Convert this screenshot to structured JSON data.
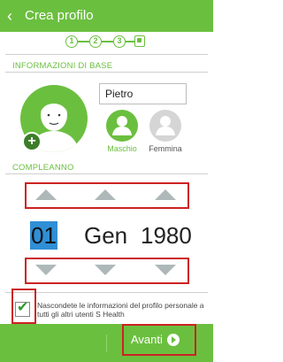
{
  "header": {
    "title": "Crea profilo",
    "back_icon": "arrow-left-icon"
  },
  "steps": {
    "current": 1,
    "labels": [
      "1",
      "2",
      "3"
    ],
    "final_icon": "profile-card-icon"
  },
  "basic_info": {
    "section_title": "INFORMAZIONI DI BASE",
    "name_value": "Pietro",
    "avatar_icon": "person-avatar-icon",
    "add_photo_icon": "plus-icon",
    "gender": {
      "male_label": "Maschio",
      "female_label": "Femmina",
      "selected": "Maschio"
    }
  },
  "birthday": {
    "section_title": "COMPLEANNO",
    "day": "01",
    "month": "Gen",
    "year": "1980"
  },
  "privacy": {
    "checked": true,
    "text": "Nascondete le informazioni del profilo personale a tutti gli altri utenti S Health"
  },
  "footer": {
    "next_label": "Avanti",
    "next_icon": "chevron-right-icon"
  },
  "colors": {
    "accent": "#6bbf3f",
    "selected_day": "#2f8fd6",
    "highlight_box": "#cc2222"
  }
}
